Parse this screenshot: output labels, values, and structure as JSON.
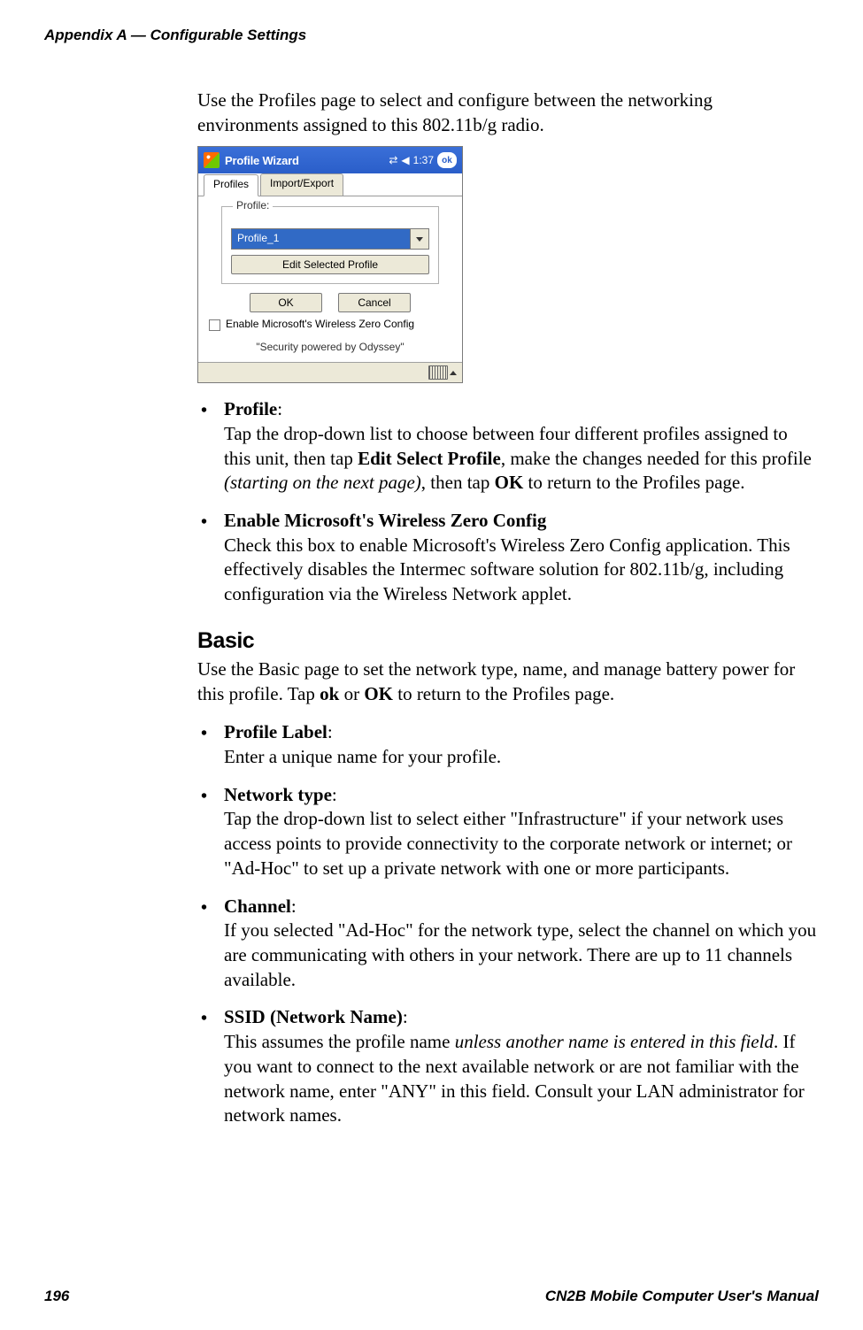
{
  "running_header": "Appendix A — Configurable Settings",
  "footer": {
    "page": "196",
    "manual": "CN2B Mobile Computer User's Manual"
  },
  "intro": "Use the Profiles page to select and configure between the networking environments assigned to this 802.11b/g radio.",
  "screenshot": {
    "titlebar": {
      "title": "Profile Wizard",
      "time": "1:37",
      "ok": "ok"
    },
    "tabs": {
      "active": "Profiles",
      "other": "Import/Export"
    },
    "group_label": "Profile:",
    "combo_value": "Profile_1",
    "edit_button": "Edit Selected Profile",
    "ok_button": "OK",
    "cancel_button": "Cancel",
    "checkbox_label": "Enable Microsoft's Wireless Zero Config",
    "footer_text": "\"Security powered by Odyssey\""
  },
  "bullets_top": [
    {
      "title": "Profile",
      "trailing_text": ":",
      "body_parts": [
        {
          "t": "Tap the drop-down list to choose between four different profiles assigned to this unit, then tap "
        },
        {
          "t": "Edit Select Profile",
          "b": true
        },
        {
          "t": ", make the changes needed for this profile "
        },
        {
          "t": "(starting on the next page)",
          "i": true
        },
        {
          "t": ", then tap "
        },
        {
          "t": "OK",
          "b": true
        },
        {
          "t": " to return to the Profiles page."
        }
      ]
    },
    {
      "title": "Enable Microsoft's Wireless Zero Config",
      "trailing_text": "",
      "body_parts": [
        {
          "t": "Check this box to enable Microsoft's Wireless Zero Config application. This effectively disables the Intermec software solution for 802.11b/g, including configuration via the Wireless Network applet."
        }
      ]
    }
  ],
  "basic": {
    "heading": "Basic",
    "intro_parts": [
      {
        "t": "Use the Basic page to set the network type, name, and manage battery power for this profile. Tap "
      },
      {
        "t": "ok",
        "b": true
      },
      {
        "t": " or "
      },
      {
        "t": "OK",
        "b": true
      },
      {
        "t": " to return to the Profiles page."
      }
    ],
    "bullets": [
      {
        "title": "Profile Label",
        "trailing": ":",
        "body": "Enter a unique name for your profile."
      },
      {
        "title": "Network type",
        "trailing": ":",
        "body": "Tap the drop-down list to select either \"Infrastructure\" if your network uses access points to provide connectivity to the corporate network or internet; or \"Ad-Hoc\" to set up a private network with one or more participants."
      },
      {
        "title": "Channel",
        "trailing": ":",
        "body": "If you selected \"Ad-Hoc\" for the network type, select the channel on which you are communicating with others in your network. There are up to 11 channels available."
      },
      {
        "title": "SSID (Network Name)",
        "trailing": ":",
        "body_parts": [
          {
            "t": "This assumes the profile name "
          },
          {
            "t": "unless another name is entered in this field",
            "i": true
          },
          {
            "t": ". If you want to connect to the next available network or are not familiar with the network name, enter \"ANY\" in this field. Consult your LAN administrator for network names."
          }
        ]
      }
    ]
  }
}
